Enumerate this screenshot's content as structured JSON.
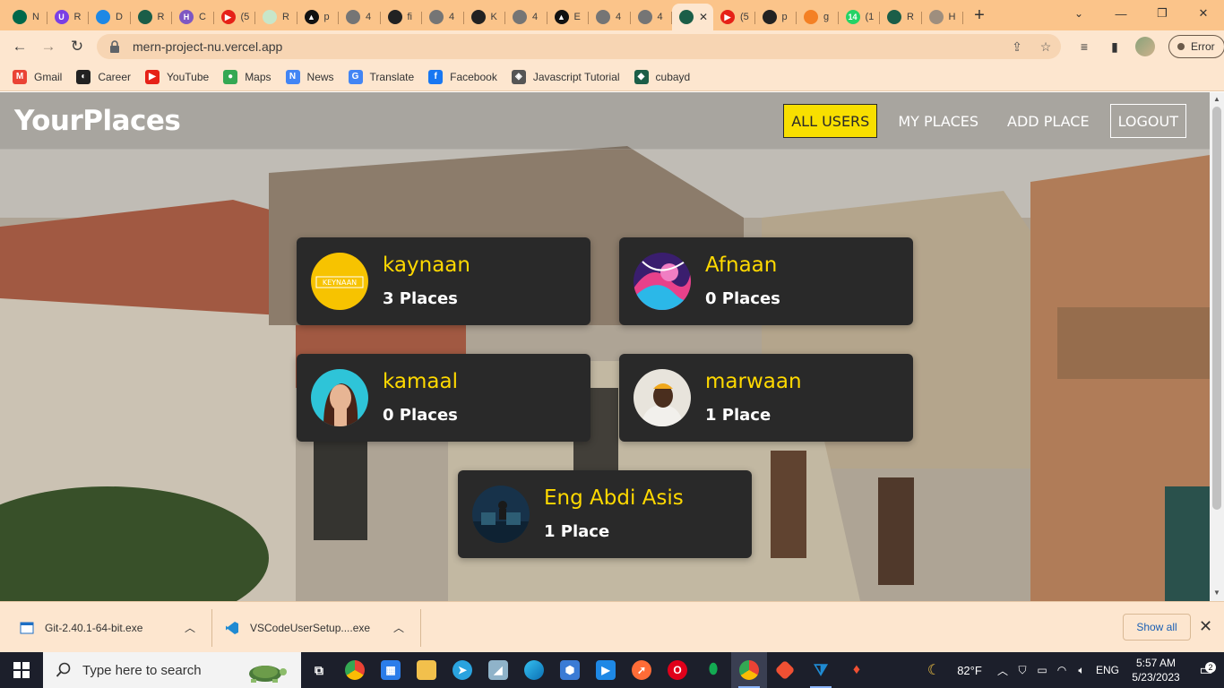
{
  "browser": {
    "tabs": [
      {
        "label": "N",
        "color": "#00684a",
        "glyph": ""
      },
      {
        "label": "R",
        "color": "#7b3fe4",
        "glyph": "U"
      },
      {
        "label": "D",
        "color": "#1e88e5",
        "glyph": ""
      },
      {
        "label": "R",
        "color": "#1b5e48",
        "glyph": ""
      },
      {
        "label": "C",
        "color": "#7e57c2",
        "glyph": "H"
      },
      {
        "label": "(5",
        "color": "#e62117",
        "glyph": "▶"
      },
      {
        "label": "R",
        "color": "#c8e6c9",
        "glyph": ""
      },
      {
        "label": "p",
        "color": "#111111",
        "glyph": "▲"
      },
      {
        "label": "4",
        "color": "#757575",
        "glyph": ""
      },
      {
        "label": "fi",
        "color": "#222222",
        "glyph": ""
      },
      {
        "label": "4",
        "color": "#757575",
        "glyph": ""
      },
      {
        "label": "K",
        "color": "#222222",
        "glyph": ""
      },
      {
        "label": "4",
        "color": "#757575",
        "glyph": ""
      },
      {
        "label": "E",
        "color": "#111111",
        "glyph": "▲"
      },
      {
        "label": "4",
        "color": "#757575",
        "glyph": ""
      },
      {
        "label": "4",
        "color": "#757575",
        "glyph": ""
      },
      {
        "label": "",
        "color": "#1b5e48",
        "glyph": "",
        "active": true
      },
      {
        "label": "(5",
        "color": "#e62117",
        "glyph": "▶"
      },
      {
        "label": "p",
        "color": "#222222",
        "glyph": ""
      },
      {
        "label": "g",
        "color": "#f48024",
        "glyph": ""
      },
      {
        "label": "(1",
        "color": "#25d366",
        "glyph": "14"
      },
      {
        "label": "R",
        "color": "#1b5e48",
        "glyph": ""
      },
      {
        "label": "H",
        "color": "#9e8e7e",
        "glyph": ""
      }
    ],
    "new_tab": "+",
    "url": "mern-project-nu.vercel.app",
    "profile_button": "Error",
    "bookmarks": [
      {
        "label": "Gmail",
        "color": "#ea4335",
        "glyph": "M"
      },
      {
        "label": "Career",
        "color": "#222222",
        "glyph": "◐"
      },
      {
        "label": "YouTube",
        "color": "#e62117",
        "glyph": "▶"
      },
      {
        "label": "Maps",
        "color": "#34a853",
        "glyph": "●"
      },
      {
        "label": "News",
        "color": "#4285f4",
        "glyph": "N"
      },
      {
        "label": "Translate",
        "color": "#4285f4",
        "glyph": "G"
      },
      {
        "label": "Facebook",
        "color": "#1877f2",
        "glyph": "f"
      },
      {
        "label": "Javascript Tutorial",
        "color": "#555555",
        "glyph": "◈"
      },
      {
        "label": "cubayd",
        "color": "#1b5e48",
        "glyph": "◆"
      }
    ]
  },
  "site": {
    "logo": "YourPlaces",
    "nav": [
      {
        "label": "ALL USERS",
        "state": "active"
      },
      {
        "label": "MY PLACES",
        "state": "normal"
      },
      {
        "label": "ADD PLACE",
        "state": "normal"
      },
      {
        "label": "LOGOUT",
        "state": "outlined"
      }
    ],
    "users": [
      {
        "name": "kaynaan",
        "places": "3 Places",
        "avatar": "keynaan-logo"
      },
      {
        "name": "Afnaan",
        "places": "0 Places",
        "avatar": "abstract-art"
      },
      {
        "name": "kamaal",
        "places": "0 Places",
        "avatar": "woman-portrait"
      },
      {
        "name": "marwaan",
        "places": "1 Place",
        "avatar": "man-portrait"
      },
      {
        "name": "Eng Abdi Asis",
        "places": "1 Place",
        "avatar": "office-photo"
      }
    ],
    "avatar_logo_text": "KEYNAAN",
    "colors": {
      "accent": "#ffd900",
      "card": "#292929",
      "active_nav": "#f8df00"
    }
  },
  "downloads": {
    "items": [
      {
        "name": "Git-2.40.1-64-bit.exe",
        "icon": "installer-icon"
      },
      {
        "name": "VSCodeUserSetup....exe",
        "icon": "vscode-icon"
      }
    ],
    "show_all": "Show all",
    "close": "✕"
  },
  "taskbar": {
    "search_placeholder": "Type here to search",
    "weather": "82°F",
    "language": "ENG",
    "time": "5:57 AM",
    "date": "5/23/2023",
    "notifications": "2"
  }
}
